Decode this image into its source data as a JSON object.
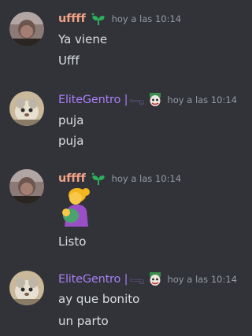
{
  "messages": [
    {
      "author": "uffff",
      "timestamp": "hoy a las 10:14",
      "lines": [
        "Ya viene",
        "Ufff"
      ]
    },
    {
      "author": "EliteGentro |",
      "author_glyph": "𓂸",
      "timestamp": "hoy a las 10:14",
      "lines": [
        "puja",
        "puja"
      ]
    },
    {
      "author": "uffff",
      "timestamp": "hoy a las 10:14",
      "emoji": "woman-breastfeeding-emoji",
      "lines": [
        "Listo"
      ]
    },
    {
      "author": "EliteGentro |",
      "author_glyph": "𓂸",
      "timestamp": "hoy a las 10:14",
      "lines": [
        "ay que bonito",
        "un parto"
      ]
    }
  ],
  "colors": {
    "background": "#313338",
    "username_uffff": "#f0a286",
    "username_elite": "#a97ff6",
    "timestamp": "#949ba4",
    "text": "#dbdee1",
    "badge_green": "#2fae5f"
  },
  "icons": {
    "uffff_badge": "sprout-icon",
    "elite_badge": "joker-icon"
  }
}
